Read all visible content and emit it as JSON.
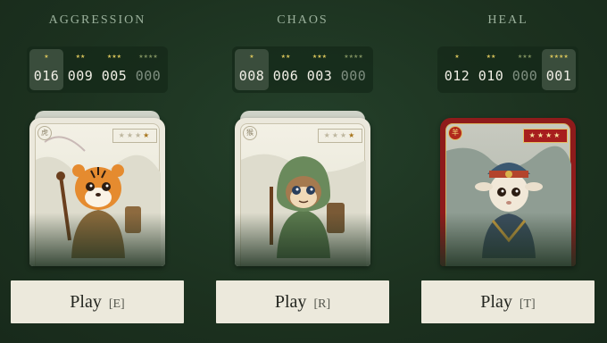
{
  "columns": [
    {
      "title": "AGGRESSION",
      "counters": [
        {
          "stars": "★",
          "value": "016"
        },
        {
          "stars": "★★",
          "value": "009"
        },
        {
          "stars": "★★★",
          "value": "005"
        },
        {
          "stars": "★★★★",
          "value": "000"
        }
      ],
      "selected_counter": 0,
      "card": {
        "character": "tiger",
        "badge": "虎",
        "stars": "★★★★",
        "lit_stars": 1,
        "frame": "cream"
      },
      "play_label": "Play",
      "play_key": "[E]"
    },
    {
      "title": "CHAOS",
      "counters": [
        {
          "stars": "★",
          "value": "008"
        },
        {
          "stars": "★★",
          "value": "006"
        },
        {
          "stars": "★★★",
          "value": "003"
        },
        {
          "stars": "★★★★",
          "value": "000"
        }
      ],
      "selected_counter": 0,
      "card": {
        "character": "monkey",
        "badge": "猴",
        "stars": "★★★★",
        "lit_stars": 1,
        "frame": "cream"
      },
      "play_label": "Play",
      "play_key": "[R]"
    },
    {
      "title": "HEAL",
      "counters": [
        {
          "stars": "★",
          "value": "012"
        },
        {
          "stars": "★★",
          "value": "010"
        },
        {
          "stars": "★★★",
          "value": "000"
        },
        {
          "stars": "★★★★",
          "value": "001"
        }
      ],
      "selected_counter": 3,
      "card": {
        "character": "goat",
        "badge": "羊",
        "stars": "★★★★",
        "lit_stars": 4,
        "frame": "red"
      },
      "play_label": "Play",
      "play_key": "[T]"
    }
  ],
  "colors": {
    "background": "#1d3120",
    "button": "#ece9dc",
    "star": "#d6c25a",
    "red_frame": "#8f1b1b"
  }
}
